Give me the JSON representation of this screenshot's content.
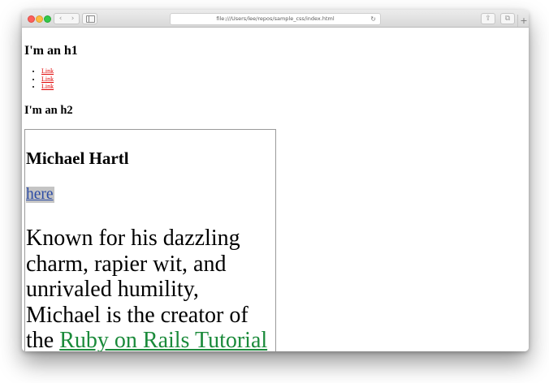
{
  "browser": {
    "url": "file:///Users/lee/repos/sample_css/index.html",
    "icons": {
      "close": "close-traffic-light",
      "minimize": "minimize-traffic-light",
      "maximize": "maximize-traffic-light",
      "back": "chevron-left-icon",
      "forward": "chevron-right-icon",
      "sidebar": "sidebar-icon",
      "reload": "reload-icon",
      "share": "share-icon",
      "tabs": "tabs-overview-icon",
      "new_tab": "plus-icon"
    },
    "glyphs": {
      "back": "‹",
      "forward": "›",
      "reload": "↻",
      "share": "⇪",
      "tabs": "⧉",
      "new_tab": "+"
    }
  },
  "page": {
    "h1": "I'm an h1",
    "links": [
      "Link",
      "Link",
      "Link"
    ],
    "h2": "I'm an h2",
    "bio": {
      "name": "Michael Hartl",
      "link": "here",
      "text_before": "Known for his dazzling charm, rapier wit, and unrivaled humility, Michael is the creator of the ",
      "text_link": "Ruby on Rails Tutorial"
    }
  },
  "colors": {
    "link_red": "#e00000",
    "bio_link_blue": "#2b4ba5",
    "bio_link_bg": "#c4c4c4",
    "tutorial_link_green": "#1a8a3a"
  }
}
